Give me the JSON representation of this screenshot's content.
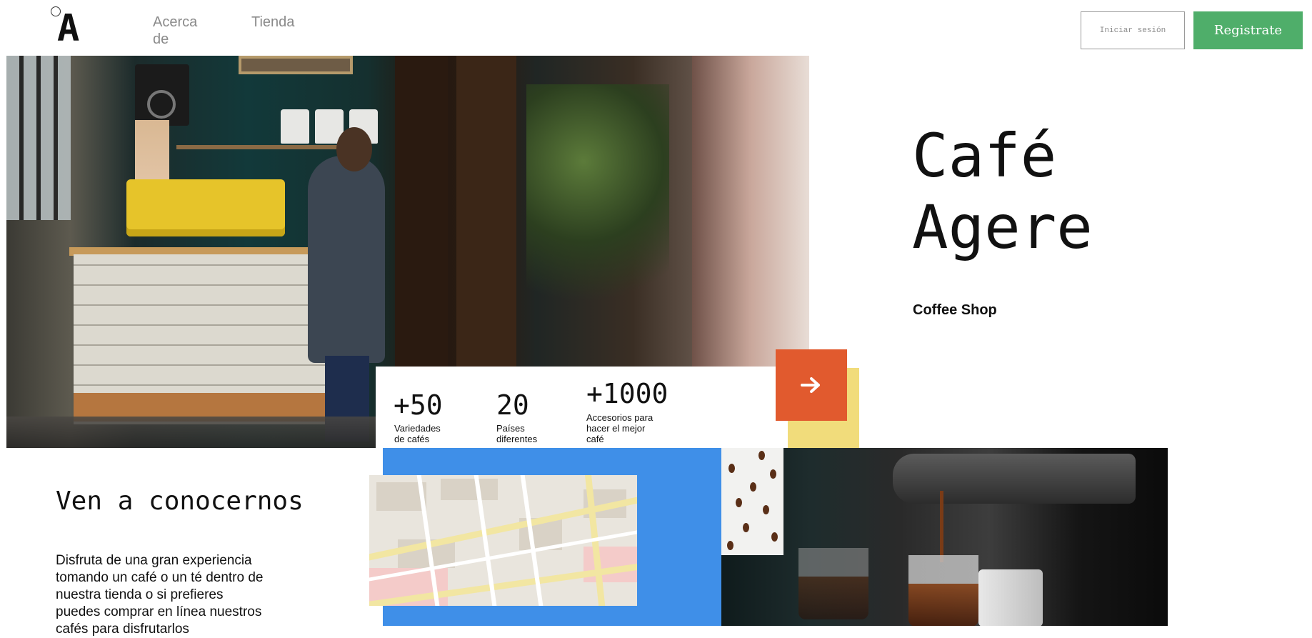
{
  "header": {
    "logo": "A",
    "nav": {
      "about": "Acerca de",
      "shop": "Tienda"
    },
    "login_label": "Iniciar sesión",
    "register_label": "Registrate"
  },
  "hero": {
    "title": "Café Agere",
    "subtitle": "Coffee Shop"
  },
  "stats": [
    {
      "value": "+50",
      "label": "Variedades de cafés"
    },
    {
      "value": "20",
      "label": "Países diferentes"
    },
    {
      "value": "+1000",
      "label": "Accesorios para hacer el mejor café"
    }
  ],
  "about": {
    "title": "Ven a conocernos",
    "body": "Disfruta de una gran experiencia tomando un café o un té dentro de nuestra tienda o si prefieres puedes comprar en línea nuestros cafés para disfrutarlos"
  },
  "colors": {
    "accent_green": "#4fae6a",
    "accent_orange": "#e15a2e",
    "accent_yellow": "#f1dc7b",
    "accent_blue": "#3f8fe8"
  },
  "icons": {
    "next": "arrow-right-icon"
  }
}
